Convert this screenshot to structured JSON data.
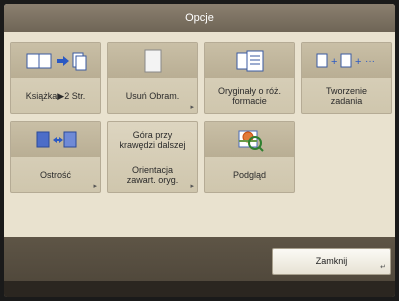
{
  "window": {
    "title": "Opcje"
  },
  "tiles": [
    {
      "label": "Książka▶2 Str.",
      "icon": "book-to-two-pages-icon"
    },
    {
      "label": "Usuń Obram.",
      "icon": "erase-frame-icon",
      "has_submenu_marker": true
    },
    {
      "label": "Oryginały o róż.\nformacie",
      "icon": "different-size-originals-icon"
    },
    {
      "label": "Tworzenie\nzadania",
      "icon": "job-build-icon"
    },
    {
      "label": "Ostrość",
      "icon": "sharpness-icon",
      "has_submenu_marker": true
    },
    {
      "top_label": "Góra przy\nkrawędzi dalszej",
      "label": "Orientacja\nzawart. oryg.",
      "icon": "",
      "has_submenu_marker": true
    },
    {
      "label": "Podgląd",
      "icon": "preview-icon"
    }
  ],
  "footer": {
    "close_label": "Zamknij"
  },
  "colors": {
    "title_bar": "#7a6f60",
    "panel": "#e9e2cf",
    "tile": "#d4cbb3"
  }
}
